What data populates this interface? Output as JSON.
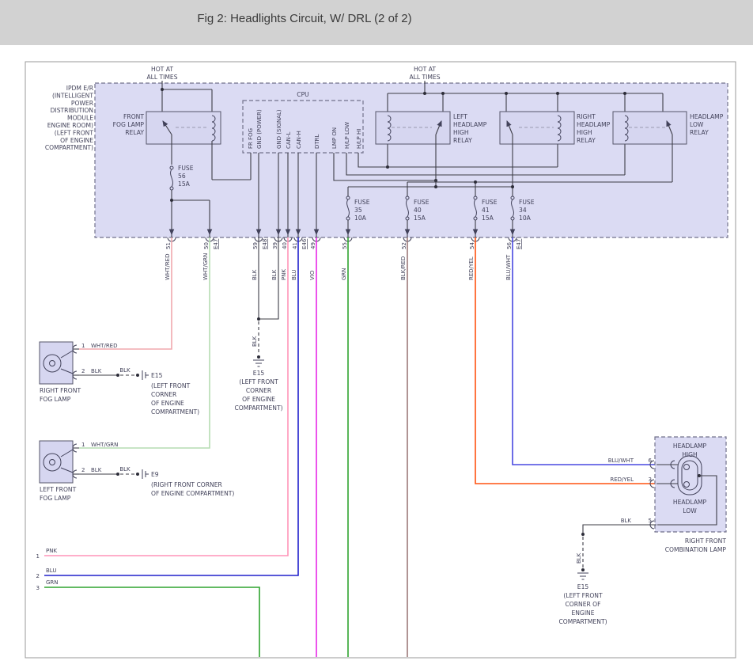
{
  "header": {
    "title": "Fig 2: Headlights Circuit, W/ DRL (2 of 2)"
  },
  "hot1": {
    "l1": "HOT AT",
    "l2": "ALL TIMES"
  },
  "hot2": {
    "l1": "HOT AT",
    "l2": "ALL TIMES"
  },
  "ipdm": {
    "label": [
      "IPDM E/R",
      "(INTELLIGENT",
      "POWER",
      "DISTRIBUTION",
      "MODULE",
      "ENGINE ROOM)",
      "(LEFT FRONT",
      "OF ENGINE",
      "COMPARTMENT)"
    ]
  },
  "cpu": {
    "title": "CPU",
    "pins": [
      "FR FOG",
      "GND (POWER)",
      "GND (SIGNAL)",
      "CAN-L",
      "CAN-H",
      "DTRL",
      "LMP ON",
      "H/LP LOW",
      "H/LP HI"
    ]
  },
  "relays": {
    "fog": [
      "FRONT",
      "FOG LAMP",
      "RELAY"
    ],
    "left": [
      "LEFT",
      "HEADLAMP",
      "HIGH",
      "RELAY"
    ],
    "right": [
      "RIGHT",
      "HEADLAMP",
      "HIGH",
      "RELAY"
    ],
    "low": [
      "HEADLAMP",
      "LOW",
      "RELAY"
    ]
  },
  "fuses": {
    "f56": [
      "FUSE",
      "56",
      "15A"
    ],
    "f35": [
      "FUSE",
      "35",
      "10A"
    ],
    "f40": [
      "FUSE",
      "40",
      "15A"
    ],
    "f41": [
      "FUSE",
      "41",
      "15A"
    ],
    "f34": [
      "FUSE",
      "34",
      "10A"
    ]
  },
  "pins": {
    "p51": {
      "n": "51",
      "w": "WHT/RED"
    },
    "p50": {
      "n": "50",
      "w": "WHT/GRN",
      "c": "E47"
    },
    "p59": {
      "n": "59",
      "w": "BLK",
      "c": "E48"
    },
    "p39": {
      "n": "39",
      "w": "BLK"
    },
    "p40": {
      "n": "40",
      "w": "PNK"
    },
    "p41": {
      "n": "41",
      "w": "BLU",
      "c": "E46"
    },
    "p49": {
      "n": "49",
      "w": "VIO"
    },
    "p55": {
      "n": "55",
      "w": "GRN"
    },
    "p52": {
      "n": "52",
      "w": "BLK/RED"
    },
    "p54": {
      "n": "54",
      "w": "RED/YEL"
    },
    "p56": {
      "n": "56",
      "w": "BLU/WHT",
      "c": "E47"
    }
  },
  "fog_r": {
    "n1": "RIGHT FRONT",
    "n2": "FOG LAMP",
    "p1n": "1",
    "p1w": "WHT/RED",
    "p2n": "2",
    "p2w": "BLK",
    "w2": "BLK",
    "gid": "E15",
    "g": [
      "(LEFT FRONT",
      "CORNER",
      "OF ENGINE",
      "COMPARTMENT)"
    ]
  },
  "fog_l": {
    "n1": "LEFT FRONT",
    "n2": "FOG LAMP",
    "p1n": "1",
    "p1w": "WHT/GRN",
    "p2n": "2",
    "p2w": "BLK",
    "w2": "BLK",
    "gid": "E9",
    "g": [
      "(RIGHT FRONT CORNER",
      "OF ENGINE COMPARTMENT)"
    ]
  },
  "gnd_c": {
    "w": "BLK",
    "id": "E15",
    "l": [
      "(LEFT FRONT",
      "CORNER",
      "OF ENGINE",
      "COMPARTMENT)"
    ]
  },
  "gnd_b": {
    "w": "BLK",
    "id": "E15",
    "l": [
      "(LEFT FRONT",
      "CORNER OF",
      "ENGINE",
      "COMPARTMENT)"
    ]
  },
  "comb": {
    "high1": "HEADLAMP",
    "high2": "HIGH",
    "low1": "HEADLAMP",
    "low2": "LOW",
    "n1": "RIGHT FRONT",
    "n2": "COMBINATION LAMP",
    "p6w": "BLU/WHT",
    "p6n": "6",
    "p3w": "RED/YEL",
    "p3n": "3",
    "p5w": "BLK",
    "p5n": "5"
  },
  "bottom": {
    "b1n": "1",
    "b1l": "PNK",
    "b2n": "2",
    "b2l": "BLU",
    "b3n": "3",
    "b3l": "GRN"
  },
  "colors": {
    "wht_red": "#f0a8ae",
    "wht_grn": "#b6dcb2",
    "blk": "#3f3f3f",
    "pnk": "#ff94b8",
    "blu": "#2020cc",
    "vio": "#e828e8",
    "grn": "#2fa42f",
    "blk_red": "#9d7a7a",
    "red_yel": "#ff5210",
    "blu_wht": "#4848e0",
    "panel_fill": "#dbdbf3",
    "header_bg": "#d2d2d2"
  }
}
